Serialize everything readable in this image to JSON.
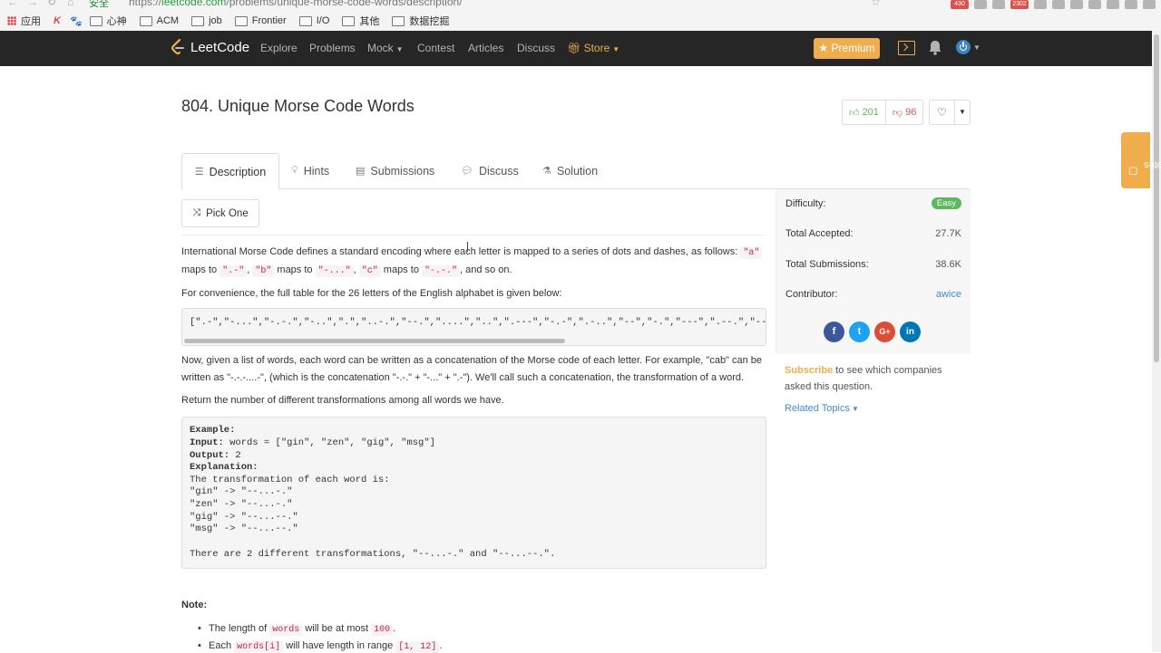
{
  "browser": {
    "secure_label": "安全",
    "url_scheme": "https://",
    "url_host": "leetcode.com",
    "url_path": "/problems/unique-morse-code-words/description/",
    "ext_badges": [
      "430",
      "2302"
    ],
    "bookmarks": [
      "应用",
      "心神",
      "ACM",
      "job",
      "Frontier",
      "I/O",
      "其他",
      "数据挖掘"
    ]
  },
  "nav": {
    "logo": "LeetCode",
    "explore": "Explore",
    "problems": "Problems",
    "mock": "Mock",
    "contest": "Contest",
    "articles": "Articles",
    "discuss": "Discuss",
    "store": "Store",
    "premium": "Premium"
  },
  "problem": {
    "title": "804. Unique Morse Code Words",
    "likes": "201",
    "dislikes": "96"
  },
  "tabs": {
    "description": "Description",
    "hints": "Hints",
    "submissions": "Submissions",
    "discuss": "Discuss",
    "solution": "Solution"
  },
  "pick_one": "Pick One",
  "content": {
    "p1_a": "International Morse Code defines a standard encoding where each letter is mapped to a series of dots and dashes, as follows: ",
    "p1_code_a": "\"a\"",
    "p1_b": "maps to ",
    "p1_code_dota": "\".-\"",
    "p1_comma1": ", ",
    "p1_code_b": "\"b\"",
    "p1_maps2": " maps to ",
    "p1_code_dotb": "\"-...\"",
    "p1_comma2": ", ",
    "p1_code_c": "\"c\"",
    "p1_maps3": " maps to ",
    "p1_code_dotc": "\"-.-.\"",
    "p1_end": ", and so on.",
    "p2": "For convenience, the full table for the 26 letters of the English alphabet is given below:",
    "table": "[\".-\",\"-...\",\"-.-.\",\"-..\",\".\",\"..-.\",\"--.\",\"....\",\"..\",\".---\",\"-.-\",\".-..\",\"--\",\"-.\",\"---\",\".--.\",\"--.-\",\".-.\",\"...\",\"-\",\"..-\",\"...-\",\".--\",\"-..-\",\"-.--\",\"--..\"]",
    "p3_l1": "Now, given a list of words, each word can be written as a concatenation of the Morse code of each letter. For example, \"cab\" can be",
    "p3_l2": "written as \"-.-.-....-\", (which is the concatenation \"-.-.\" + \"-...\" + \".-\"). We'll call such a concatenation, the transformation of a word.",
    "p4": "Return the number of different transformations among all words we have.",
    "ex_label": "Example:",
    "ex_input_label": "Input:",
    "ex_input": " words = [\"gin\", \"zen\", \"gig\", \"msg\"]",
    "ex_output_label": "Output:",
    "ex_output": " 2",
    "ex_expl_label": "Explanation:",
    "ex_l1": "The transformation of each word is:",
    "ex_l2": "\"gin\" -> \"--...-.\"",
    "ex_l3": "\"zen\" -> \"--...-.\"",
    "ex_l4": "\"gig\" -> \"--...--.\"",
    "ex_l5": "\"msg\" -> \"--...--.\"",
    "ex_l6": "There are 2 different transformations, \"--...-.\" and \"--...--.\".",
    "note": "Note:",
    "b1_a": "The length of ",
    "b1_code1": "words",
    "b1_b": " will be at most ",
    "b1_code2": "100",
    "b1_c": ".",
    "b2_a": "Each ",
    "b2_code1": "words[i]",
    "b2_b": " will have length in range ",
    "b2_code2": "[1, 12]",
    "b2_c": "."
  },
  "sidebar": {
    "difficulty_label": "Difficulty:",
    "difficulty": "Easy",
    "accepted_label": "Total Accepted:",
    "accepted": "27.7K",
    "submissions_label": "Total Submissions:",
    "submissions": "38.6K",
    "contributor_label": "Contributor:",
    "contributor": "awice",
    "subscribe": "Subscribe",
    "subscribe_rest": " to see which companies asked this question.",
    "related": "Related Topics"
  },
  "notes_tab": "Notes",
  "colors": {
    "nav_bg": "#262626",
    "accent": "#f0ad4e",
    "easy": "#5cb85c",
    "link": "#428bca"
  }
}
